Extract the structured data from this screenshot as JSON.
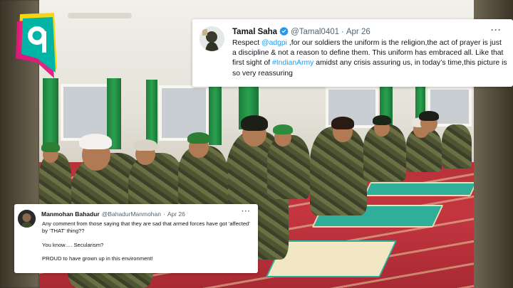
{
  "brand": {
    "logo_letter": "q",
    "colors": {
      "teal": "#00b5a5",
      "yellow": "#f7d511",
      "pink": "#e2187c"
    }
  },
  "tweet_main": {
    "name": "Tamal Saha",
    "handle": "@Tamal0401",
    "separator": "·",
    "date": "Apr 26",
    "text_1": "Respect ",
    "mention": "@adgpi",
    "text_2": " ,for our soldiers the uniform is the religion,the act of prayer is just a discipline & not a reason to define them. This uniform has embraced all. Like that first sight of ",
    "hashtag": "#IndianArmy",
    "text_3": " amidst any crisis assuring us, in today’s time,this picture is so very reassuring",
    "more_icon": "···",
    "verified_color": "#1d9bf0"
  },
  "tweet_reply": {
    "name": "Manmohan Bahadur",
    "handle": "@BahadurManmohan",
    "separator": "·",
    "date": "Apr 26",
    "line_1": "Any comment from those saying that they are sad that armed forces have got ‘affected’ by ‘THAT’ thing??",
    "line_2": "You know…. Secularism?",
    "line_3": "PROUD to have grown up in this environment!",
    "more_icon": "···"
  }
}
